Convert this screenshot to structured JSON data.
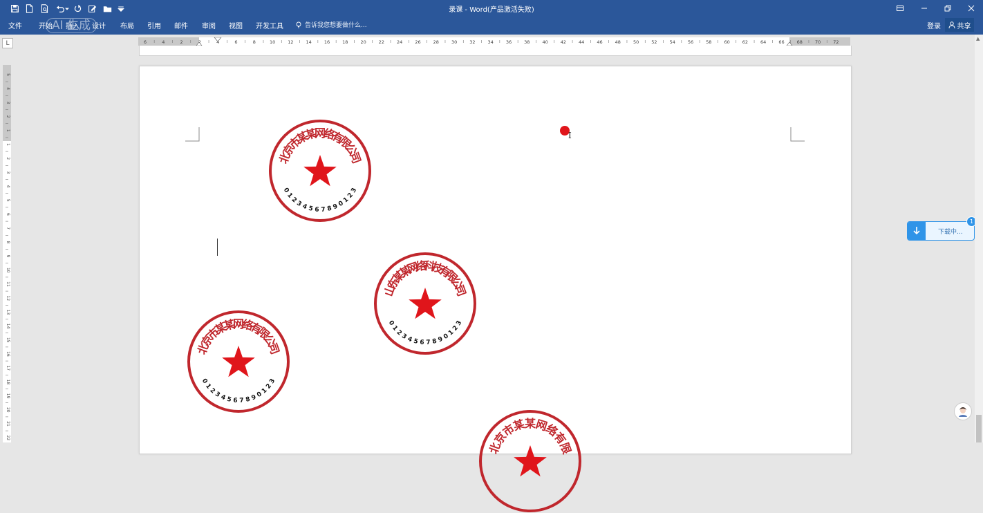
{
  "window": {
    "title": "录课 - Word(产品激活失败)",
    "login_label": "登录",
    "share_label": "共享"
  },
  "ribbon": {
    "tabs": [
      "文件",
      "开始",
      "插入",
      "设计",
      "布局",
      "引用",
      "邮件",
      "审阅",
      "视图",
      "开发工具"
    ],
    "tell_me": "告诉我您想要做什么..."
  },
  "watermark": {
    "text": "AI 生成"
  },
  "ruler": {
    "corner": "L",
    "h_labels": [
      "6",
      "4",
      "2",
      "2",
      "4",
      "6",
      "8",
      "10",
      "12",
      "14",
      "16",
      "18",
      "20",
      "22",
      "24",
      "26",
      "28",
      "30",
      "32",
      "34",
      "36",
      "38",
      "40",
      "42",
      "44",
      "46",
      "48",
      "50",
      "52",
      "54",
      "56",
      "58",
      "60",
      "62",
      "64",
      "66",
      "68",
      "70",
      "72"
    ],
    "v_labels": [
      "5",
      "4",
      "3",
      "2",
      "1",
      "1",
      "2",
      "3",
      "4",
      "5",
      "6",
      "7",
      "8",
      "9",
      "10",
      "11",
      "12",
      "13",
      "14",
      "15",
      "16",
      "17",
      "18",
      "19",
      "20",
      "21",
      "22"
    ]
  },
  "stamps": [
    {
      "company": "北京市某某网络有限公司",
      "number": "01234567890123",
      "color": "#c0272d",
      "star_color": "#e0151b"
    },
    {
      "company": "山东某某网络科技有限公司",
      "number": "01234567890123",
      "color": "#c0272d",
      "star_color": "#e0151b"
    },
    {
      "company": "北京市某某网络有限公司",
      "number": "01234567890123",
      "color": "#c0272d",
      "star_color": "#e0151b"
    },
    {
      "company": "北京市某某网络有限",
      "number": "",
      "color": "#c0272d",
      "star_color": "#e0151b"
    }
  ],
  "download": {
    "label": "下载中...",
    "badge": "1",
    "accent": "#2f94e8"
  },
  "colors": {
    "title_bar": "#2b579a",
    "page": "#ffffff",
    "canvas": "#e6e6e6"
  }
}
